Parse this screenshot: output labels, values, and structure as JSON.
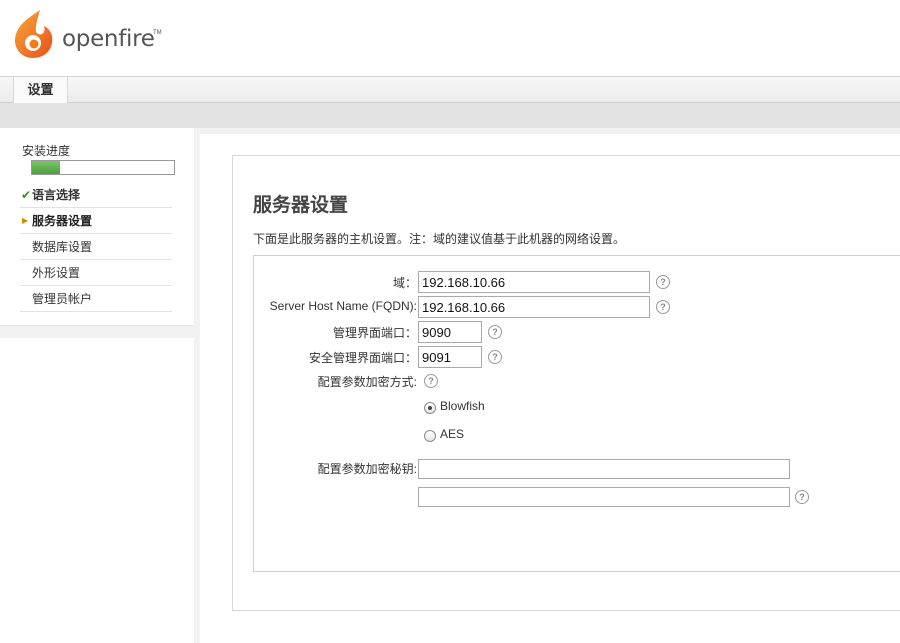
{
  "header": {
    "logo_text": "openfire",
    "logo_tm": "TM"
  },
  "nav": {
    "tab_label": "设置"
  },
  "sidebar": {
    "progress_label": "安装进度",
    "progress_fraction": 0.2,
    "steps": [
      {
        "label": "语言选择",
        "state": "done"
      },
      {
        "label": "服务器设置",
        "state": "current"
      },
      {
        "label": "数据库设置",
        "state": "pending"
      },
      {
        "label": "外形设置",
        "state": "pending"
      },
      {
        "label": "管理员帐户",
        "state": "pending"
      }
    ]
  },
  "main": {
    "title": "服务器设置",
    "description": "下面是此服务器的主机设置。注：域的建议值基于此机器的网络设置。",
    "form": {
      "domain_label": "域：",
      "domain_value": "192.168.10.66",
      "fqdn_label": "Server Host Name (FQDN):",
      "fqdn_value": "192.168.10.66",
      "admin_port_label": "管理界面端口：",
      "admin_port_value": "9090",
      "secure_port_label": "安全管理界面端口：",
      "secure_port_value": "9091",
      "encryption_label": "配置参数加密方式:",
      "encryption_options": [
        "Blowfish",
        "AES"
      ],
      "encryption_selected": "Blowfish",
      "key_label": "配置参数加密秘钥:",
      "key_value": "",
      "key_confirm_value": ""
    }
  },
  "colors": {
    "progress_green": "#5aab48",
    "check_green": "#3a8a2a",
    "arrow_orange": "#d08a00",
    "logo_orange": "#f07d1a"
  }
}
